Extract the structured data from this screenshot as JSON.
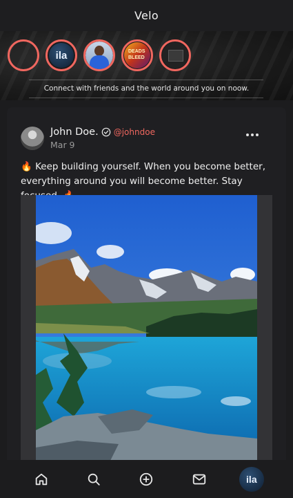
{
  "app": {
    "title": "Velo"
  },
  "stories": {
    "items": [
      {
        "kind": "empty"
      },
      {
        "kind": "logo",
        "label": "ila"
      },
      {
        "kind": "person"
      },
      {
        "kind": "poster",
        "label": "DEADS BLEED"
      },
      {
        "kind": "screen"
      }
    ],
    "tagline": "Connect with friends and the world around you on noow."
  },
  "post": {
    "author": "John Doe.",
    "handle": "@johndoe",
    "date": "Mar 9",
    "text": "🔥 Keep building yourself. When you become better, everything around you will become better. Stay focused. 🔥",
    "image": "mountain-lake-photo"
  },
  "tabbar": {
    "items": [
      "home-icon",
      "search-icon",
      "add-post-icon",
      "messages-icon",
      "profile-avatar"
    ],
    "profile_label": "ila"
  },
  "colors": {
    "accent": "#f0675f",
    "background": "#1c1c1e",
    "card": "#1f1f22"
  }
}
